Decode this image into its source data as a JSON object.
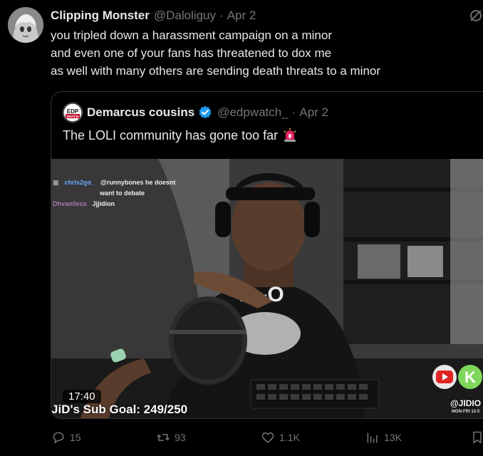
{
  "tweet": {
    "author_name": "Clipping Monster",
    "author_handle": "@Daloliguy",
    "separator": "·",
    "date": "Apr 2",
    "text_lines": [
      "you tripled down a harassment campaign on a minor",
      "and even one of your fans has threatened to dox me",
      "as well with many others are sending death threats to a minor"
    ]
  },
  "quote": {
    "author_name": "Demarcus cousins",
    "author_handle": "@edpwatch_",
    "separator": "·",
    "date": "Apr 2",
    "text": "The LOLI community has gone too far",
    "text_emoji": "🚨",
    "avatar_text": "EDP WATCH",
    "media": {
      "chat": [
        {
          "user": "chris2go_",
          "message": "@runnybones he doesnt"
        },
        {
          "user": "",
          "message": "want to debate"
        },
        {
          "user": "Dhvanilesa",
          "message": "Jjjidion"
        }
      ],
      "shirt_text": "ve-O",
      "timecode": "17:40",
      "sub_goal": "JiD's Sub Goal: 249/250",
      "brand_handle": "@JIDIO",
      "brand_schedule": "MON-FRI 12-5"
    }
  },
  "actions": {
    "reply_count": "15",
    "retweet_count": "93",
    "like_count": "1.1K",
    "view_count": "13K"
  },
  "colors": {
    "background": "#000000",
    "text": "#e7e9ea",
    "muted": "#71767b",
    "border": "#2f3336",
    "verified": "#1d9bf0"
  }
}
